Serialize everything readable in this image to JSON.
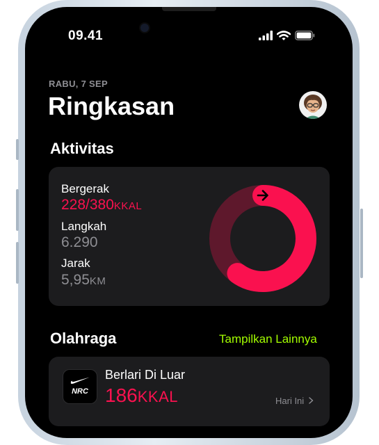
{
  "status_bar": {
    "time": "09.41"
  },
  "header": {
    "date": "RABU, 7 SEP",
    "title": "Ringkasan"
  },
  "activity": {
    "section_title": "Aktivitas",
    "move": {
      "label": "Bergerak",
      "value": "228/380",
      "unit": "KKAL",
      "progress": 0.6
    },
    "steps": {
      "label": "Langkah",
      "value": "6.290"
    },
    "distance": {
      "label": "Jarak",
      "value": "5,95",
      "unit": "KM"
    }
  },
  "workouts": {
    "section_title": "Olahraga",
    "show_more": "Tampilkan Lainnya",
    "item": {
      "logo_text": "NRC",
      "name": "Berlari Di Luar",
      "calories": "186",
      "unit": "KKAL",
      "date": "Hari Ini"
    }
  },
  "colors": {
    "move_ring": "#fa114f",
    "accent_green": "#a4ff00",
    "card_bg": "#1c1c1e"
  }
}
